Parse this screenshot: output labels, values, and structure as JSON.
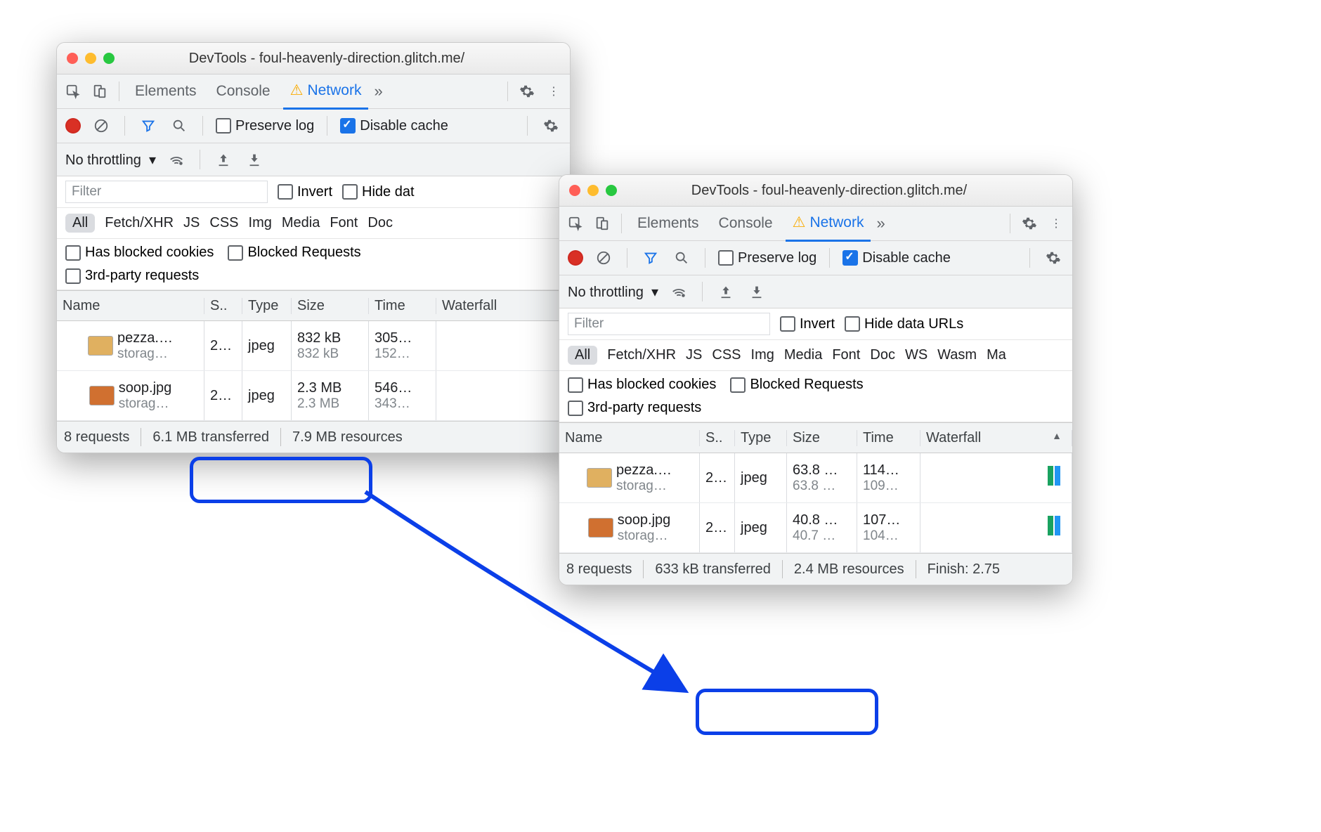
{
  "win1": {
    "title": "DevTools - foul-heavenly-direction.glitch.me/",
    "tabs": {
      "elements": "Elements",
      "console": "Console",
      "network": "Network"
    },
    "toolbar": {
      "preserve_log": "Preserve log",
      "disable_cache": "Disable cache"
    },
    "throttle": {
      "no_throttling": "No throttling"
    },
    "filter": {
      "placeholder": "Filter",
      "invert": "Invert",
      "hide_data": "Hide dat",
      "types": [
        "All",
        "Fetch/XHR",
        "JS",
        "CSS",
        "Img",
        "Media",
        "Font",
        "Doc"
      ],
      "blocked_cookies": "Has blocked cookies",
      "blocked_requests": "Blocked Requests",
      "third_party": "3rd-party requests"
    },
    "columns": {
      "name": "Name",
      "status": "S..",
      "type": "Type",
      "size": "Size",
      "time": "Time",
      "waterfall": "Waterfall"
    },
    "rows": [
      {
        "name": "pezza.…",
        "domain": "storag…",
        "status": "2…",
        "type": "jpeg",
        "size1": "832 kB",
        "size2": "832 kB",
        "time1": "305…",
        "time2": "152…"
      },
      {
        "name": "soop.jpg",
        "domain": "storag…",
        "status": "2…",
        "type": "jpeg",
        "size1": "2.3 MB",
        "size2": "2.3 MB",
        "time1": "546…",
        "time2": "343…"
      }
    ],
    "status": {
      "requests": "8 requests",
      "transferred": "6.1 MB transferred",
      "resources": "7.9 MB resources"
    }
  },
  "win2": {
    "title": "DevTools - foul-heavenly-direction.glitch.me/",
    "tabs": {
      "elements": "Elements",
      "console": "Console",
      "network": "Network"
    },
    "toolbar": {
      "preserve_log": "Preserve log",
      "disable_cache": "Disable cache"
    },
    "throttle": {
      "no_throttling": "No throttling"
    },
    "filter": {
      "placeholder": "Filter",
      "invert": "Invert",
      "hide_data": "Hide data URLs",
      "types": [
        "All",
        "Fetch/XHR",
        "JS",
        "CSS",
        "Img",
        "Media",
        "Font",
        "Doc",
        "WS",
        "Wasm",
        "Ma"
      ],
      "blocked_cookies": "Has blocked cookies",
      "blocked_requests": "Blocked Requests",
      "third_party": "3rd-party requests"
    },
    "columns": {
      "name": "Name",
      "status": "S..",
      "type": "Type",
      "size": "Size",
      "time": "Time",
      "waterfall": "Waterfall"
    },
    "rows": [
      {
        "name": "pezza.…",
        "domain": "storag…",
        "status": "2…",
        "type": "jpeg",
        "size1": "63.8 …",
        "size2": "63.8 …",
        "time1": "114…",
        "time2": "109…"
      },
      {
        "name": "soop.jpg",
        "domain": "storag…",
        "status": "2…",
        "type": "jpeg",
        "size1": "40.8 …",
        "size2": "40.7 …",
        "time1": "107…",
        "time2": "104…"
      }
    ],
    "status": {
      "requests": "8 requests",
      "transferred": "633 kB transferred",
      "resources": "2.4 MB resources",
      "finish": "Finish: 2.75"
    }
  }
}
